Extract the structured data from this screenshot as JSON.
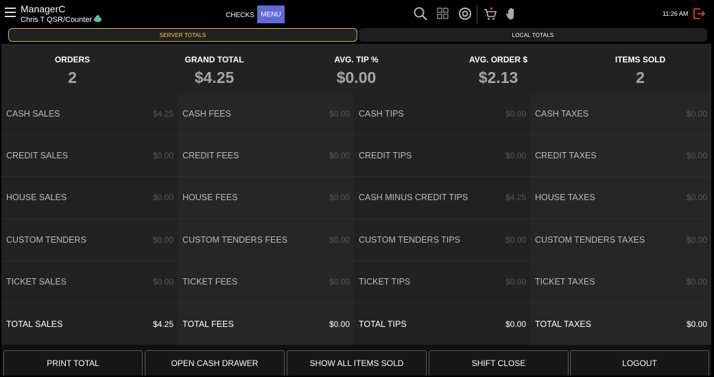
{
  "header": {
    "user_name": "ManagerC",
    "user_subtitle": "Chris T QSR/Counter",
    "checks_label": "CHECKS",
    "menu_label": "MENU",
    "time": "11:26 AM"
  },
  "tabs": [
    {
      "label": "SERVER TOTALS",
      "active": true
    },
    {
      "label": "LOCAL TOTALS",
      "active": false
    }
  ],
  "stats": [
    {
      "label": "ORDERS",
      "value": "2"
    },
    {
      "label": "GRAND TOTAL",
      "value": "$4.25"
    },
    {
      "label": "AVG. TIP %",
      "value": "$0.00"
    },
    {
      "label": "AVG. ORDER $",
      "value": "$2.13"
    },
    {
      "label": "ITEMS SOLD",
      "value": "2"
    }
  ],
  "columns": [
    {
      "rows": [
        {
          "label": "CASH SALES",
          "value": "$4.25"
        },
        {
          "label": "CREDIT SALES",
          "value": "$0.00"
        },
        {
          "label": "HOUSE SALES",
          "value": "$0.00"
        },
        {
          "label": "CUSTOM TENDERS",
          "value": "$0.00"
        },
        {
          "label": "TICKET SALES",
          "value": "$0.00"
        },
        {
          "label": "TOTAL SALES",
          "value": "$4.25"
        }
      ]
    },
    {
      "rows": [
        {
          "label": "CASH FEES",
          "value": "$0.00"
        },
        {
          "label": "CREDIT FEES",
          "value": "$0.00"
        },
        {
          "label": "HOUSE FEES",
          "value": "$0.00"
        },
        {
          "label": "CUSTOM TENDERS FEES",
          "value": "$0.00"
        },
        {
          "label": "TICKET FEES",
          "value": "$0.00"
        },
        {
          "label": "TOTAL FEES",
          "value": "$0.00"
        }
      ]
    },
    {
      "rows": [
        {
          "label": "CASH TIPS",
          "value": "$0.00"
        },
        {
          "label": "CREDIT TIPS",
          "value": "$0.00"
        },
        {
          "label": "CASH MINUS CREDIT TIPS",
          "value": "$4.25"
        },
        {
          "label": "CUSTOM TENDERS TIPS",
          "value": "$0.00"
        },
        {
          "label": "TICKET TIPS",
          "value": "$0.00"
        },
        {
          "label": "TOTAL TIPS",
          "value": "$0.00"
        }
      ]
    },
    {
      "rows": [
        {
          "label": "CASH TAXES",
          "value": "$0.00"
        },
        {
          "label": "CREDIT TAXES",
          "value": "$0.00"
        },
        {
          "label": "HOUSE TAXES",
          "value": "$0.00"
        },
        {
          "label": "CUSTOM TENDERS TAXES",
          "value": "$0.00"
        },
        {
          "label": "TICKET TAXES",
          "value": "$0.00"
        },
        {
          "label": "TOTAL TAXES",
          "value": "$0.00"
        }
      ]
    }
  ],
  "actions": {
    "print_total": "PRINT TOTAL",
    "open_cash_drawer": "OPEN CASH DRAWER",
    "show_all_items_sold": "SHOW ALL ITEMS SOLD",
    "shift_close": "SHIFT CLOSE",
    "logout": "LOGOUT"
  },
  "colors": {
    "accent_menu": "#5f6ad8",
    "tab_active_border": "#d2b93c",
    "cloud_status": "#3ecf9a",
    "cart_badge": "#e03a3a",
    "logout_icon": "#e03a3a"
  },
  "icons": {
    "menu": "hamburger-icon",
    "status": "cloud-icon",
    "search": "search-icon",
    "grid": "grid-icon",
    "target": "target-icon",
    "cart": "cart-icon",
    "hand": "hand-icon",
    "logout": "logout-icon"
  }
}
